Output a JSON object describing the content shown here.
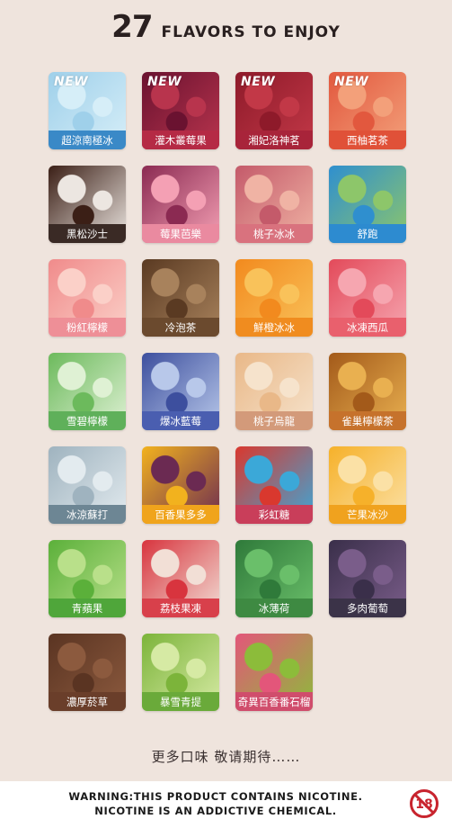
{
  "header": {
    "count": "27",
    "title": "FLAVORS TO ENJOY"
  },
  "flavors": [
    {
      "name": "超涼南極冰",
      "new": "NEW",
      "colors": [
        "#9fd0ea",
        "#d6eef8"
      ],
      "label_bg": "#3a89c7"
    },
    {
      "name": "灌木叢莓果",
      "new": "NEW",
      "colors": [
        "#6a1230",
        "#b8344d"
      ],
      "label_bg": "#b52a45"
    },
    {
      "name": "湘妃洛神茗",
      "new": "NEW",
      "colors": [
        "#8e1a2a",
        "#c23847"
      ],
      "label_bg": "#a8243a"
    },
    {
      "name": "西柚茗茶",
      "new": "NEW",
      "colors": [
        "#e2583e",
        "#f3a07a"
      ],
      "label_bg": "#e05138"
    },
    {
      "name": "黑松沙士",
      "new": "",
      "colors": [
        "#3b1f16",
        "#ece6e1"
      ],
      "label_bg": "#3a2a25"
    },
    {
      "name": "莓果芭樂",
      "new": "",
      "colors": [
        "#8b2a52",
        "#f4a0b4"
      ],
      "label_bg": "#ea8aa0"
    },
    {
      "name": "桃子冰冰",
      "new": "",
      "colors": [
        "#c45a6a",
        "#f0b3a4"
      ],
      "label_bg": "#d9727e"
    },
    {
      "name": "舒跑",
      "new": "",
      "colors": [
        "#2f8fcf",
        "#8dc66a"
      ],
      "label_bg": "#2d8bd0"
    },
    {
      "name": "粉紅檸檬",
      "new": "",
      "colors": [
        "#f08b8b",
        "#fbd0c8"
      ],
      "label_bg": "#ee8f97"
    },
    {
      "name": "冷泡茶",
      "new": "",
      "colors": [
        "#5a3a22",
        "#a8825c"
      ],
      "label_bg": "#6b4a2e"
    },
    {
      "name": "鮮橙冰冰",
      "new": "",
      "colors": [
        "#f28a1e",
        "#f9c25a"
      ],
      "label_bg": "#f08c1f"
    },
    {
      "name": "冰凍西瓜",
      "new": "",
      "colors": [
        "#e34a5a",
        "#f6a6b0"
      ],
      "label_bg": "#e9606d"
    },
    {
      "name": "雪碧檸檬",
      "new": "",
      "colors": [
        "#6cba5c",
        "#dff1d4"
      ],
      "label_bg": "#5fb05a"
    },
    {
      "name": "爆冰藍莓",
      "new": "",
      "colors": [
        "#3d4f9e",
        "#b8c8ea"
      ],
      "label_bg": "#4a5eb0"
    },
    {
      "name": "桃子烏龍",
      "new": "",
      "colors": [
        "#e9b888",
        "#f6e3cc"
      ],
      "label_bg": "#d39a7a"
    },
    {
      "name": "雀巢檸檬茶",
      "new": "",
      "colors": [
        "#a35a1a",
        "#e9b050"
      ],
      "label_bg": "#c6722c"
    },
    {
      "name": "冰涼蘇打",
      "new": "",
      "colors": [
        "#9fb3bf",
        "#e3ebef"
      ],
      "label_bg": "#6d8694"
    },
    {
      "name": "百香果多多",
      "new": "",
      "colors": [
        "#f2b21e",
        "#6b2a52"
      ],
      "label_bg": "#f0a41c"
    },
    {
      "name": "彩虹糖",
      "new": "",
      "colors": [
        "#d9382e",
        "#3ba8d8"
      ],
      "label_bg": "#c93e5a"
    },
    {
      "name": "芒果冰沙",
      "new": "",
      "colors": [
        "#f6b12a",
        "#fbe1a6"
      ],
      "label_bg": "#f0a21e"
    },
    {
      "name": "青蘋果",
      "new": "",
      "colors": [
        "#5bb03a",
        "#b9e08a"
      ],
      "label_bg": "#4fa63a"
    },
    {
      "name": "荔枝果凍",
      "new": "",
      "colors": [
        "#d8343e",
        "#f2dfd6"
      ],
      "label_bg": "#d8404b"
    },
    {
      "name": "冰薄荷",
      "new": "",
      "colors": [
        "#2f7a3a",
        "#6abf6a"
      ],
      "label_bg": "#3e8a42"
    },
    {
      "name": "多肉葡萄",
      "new": "",
      "colors": [
        "#3a2f4a",
        "#7a5d8a"
      ],
      "label_bg": "#3b3348"
    },
    {
      "name": "濃厚菸草",
      "new": "",
      "colors": [
        "#5a3422",
        "#8c5a3e"
      ],
      "label_bg": "#6a3e2a"
    },
    {
      "name": "暴雪青提",
      "new": "",
      "colors": [
        "#7cb43a",
        "#d6eaa4"
      ],
      "label_bg": "#6aaa3a"
    },
    {
      "name": "奇異百香番石榴",
      "new": "",
      "colors": [
        "#e3567a",
        "#8cbc3a"
      ],
      "label_bg": "#d04d6c"
    }
  ],
  "more_text": "更多口味 敬请期待……",
  "warning": {
    "line1": "WARNING:THIS PRODUCT CONTAINS NICOTINE.",
    "line2": "NICOTINE IS AN ADDICTIVE CHEMICAL."
  },
  "age_badge": {
    "text": "18",
    "color": "#c8242e"
  }
}
